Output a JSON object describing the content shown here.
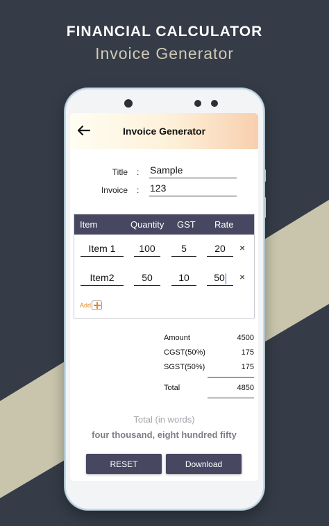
{
  "promo": {
    "title": "FINANCIAL CALCULATOR",
    "subtitle": "Invoice Generator"
  },
  "colors": {
    "background_dark": "#353c47",
    "background_light": "#c9c5ad",
    "accent": "#474761",
    "add_orange": "#e08a26"
  },
  "app": {
    "back_icon": "arrow-left-icon",
    "title": "Invoice Generator"
  },
  "form": {
    "title_label": "Title",
    "title_value": "Sample",
    "invoice_label": "Invoice",
    "invoice_value": "123",
    "colon": ":"
  },
  "items_table": {
    "headers": [
      "Item",
      "Quantity",
      "GST",
      "Rate"
    ],
    "rows": [
      {
        "item": "Item 1",
        "quantity": "100",
        "gst": "5",
        "rate": "20"
      },
      {
        "item": "Item2",
        "quantity": "50",
        "gst": "10",
        "rate": "50"
      }
    ],
    "remove_symbol": "×",
    "add_label": "Add"
  },
  "summary": {
    "amount_label": "Amount",
    "amount_value": "4500",
    "cgst_label": "CGST(50%)",
    "cgst_value": "175",
    "sgst_label": "SGST(50%)",
    "sgst_value": "175",
    "total_label": "Total",
    "total_value": "4850"
  },
  "words": {
    "label": "Total (in words)",
    "value": "four thousand, eight hundred fifty"
  },
  "buttons": {
    "reset": "RESET",
    "download": "Download"
  }
}
